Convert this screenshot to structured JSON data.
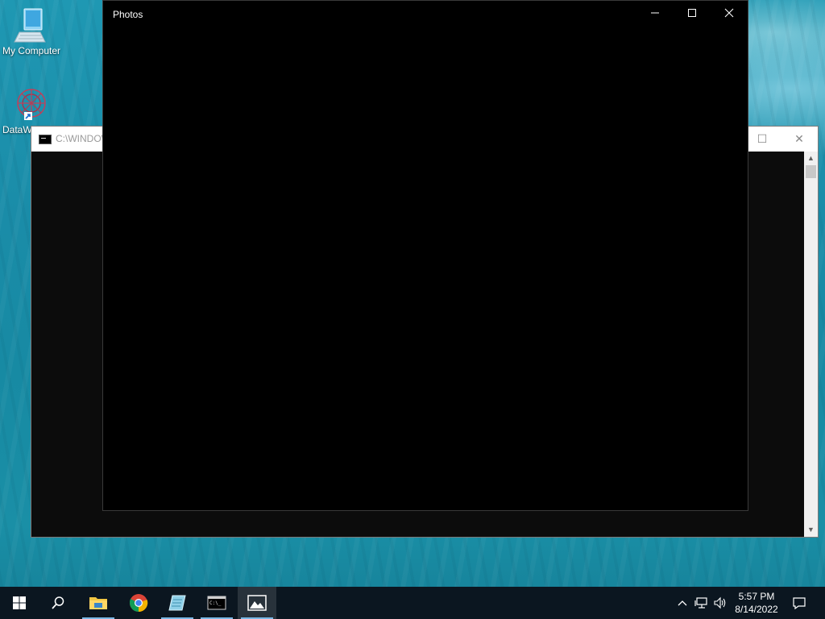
{
  "desktop": {
    "icons": [
      {
        "label": "My Computer",
        "icon": "computer-icon"
      },
      {
        "label": "DataW",
        "icon": "datawrapper-icon"
      }
    ]
  },
  "console_window": {
    "title": "C:\\WINDOW",
    "icon": "cmd-icon"
  },
  "photos_window": {
    "title": "Photos",
    "minimize_glyph": "—",
    "maximize_glyph": "☐",
    "close_glyph": "✕"
  },
  "taskbar": {
    "apps": [
      "start-icon",
      "search-icon",
      "file-explorer-icon",
      "chrome-icon",
      "notepad-icon",
      "cmd-icon",
      "photos-icon"
    ],
    "active_app": "photos-icon",
    "clock": {
      "time": "5:57 PM",
      "date": "8/14/2022"
    },
    "tray": [
      "chevron-up-icon",
      "network-icon",
      "volume-icon"
    ],
    "notification": "action-center-icon"
  },
  "colors": {
    "taskbar": "#0b1620",
    "desktop": "#1a8ca8",
    "photos_bg": "#000000",
    "console_bg": "#0c0c0c",
    "active_underline": "#7ab8e6"
  }
}
